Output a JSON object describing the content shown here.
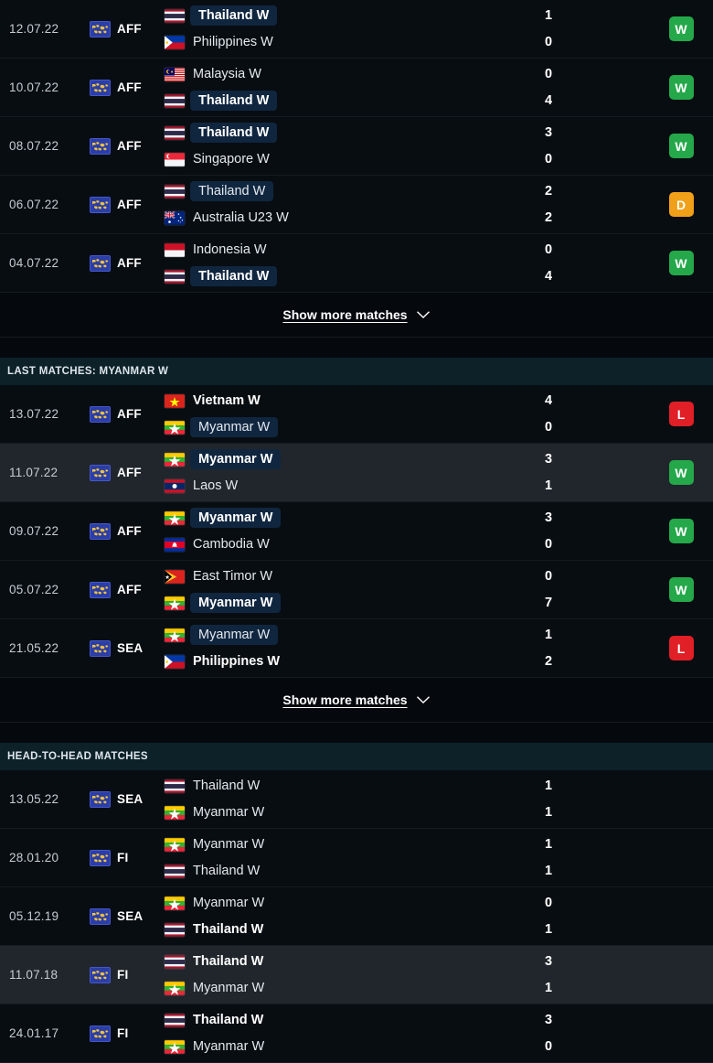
{
  "sections": [
    {
      "id": "last-matches-thailand",
      "header": null,
      "show_more_label": "Show more matches",
      "matches": [
        {
          "date": "12.07.22",
          "competition": "AFF",
          "comp_icon": "world-map-icon",
          "alt": false,
          "home": {
            "name": "Thailand W",
            "flag": "thailand",
            "highlight": true,
            "winner": true
          },
          "away": {
            "name": "Philippines W",
            "flag": "philippines",
            "highlight": false,
            "winner": false
          },
          "score_home": "1",
          "score_away": "0",
          "result": "W"
        },
        {
          "date": "10.07.22",
          "competition": "AFF",
          "comp_icon": "world-map-icon",
          "alt": false,
          "home": {
            "name": "Malaysia W",
            "flag": "malaysia",
            "highlight": false,
            "winner": false
          },
          "away": {
            "name": "Thailand W",
            "flag": "thailand",
            "highlight": true,
            "winner": true
          },
          "score_home": "0",
          "score_away": "4",
          "result": "W"
        },
        {
          "date": "08.07.22",
          "competition": "AFF",
          "comp_icon": "world-map-icon",
          "alt": false,
          "home": {
            "name": "Thailand W",
            "flag": "thailand",
            "highlight": true,
            "winner": true
          },
          "away": {
            "name": "Singapore W",
            "flag": "singapore",
            "highlight": false,
            "winner": false
          },
          "score_home": "3",
          "score_away": "0",
          "result": "W"
        },
        {
          "date": "06.07.22",
          "competition": "AFF",
          "comp_icon": "world-map-icon",
          "alt": false,
          "home": {
            "name": "Thailand W",
            "flag": "thailand",
            "highlight": true,
            "winner": false
          },
          "away": {
            "name": "Australia U23 W",
            "flag": "australia",
            "highlight": false,
            "winner": false
          },
          "score_home": "2",
          "score_away": "2",
          "result": "D"
        },
        {
          "date": "04.07.22",
          "competition": "AFF",
          "comp_icon": "world-map-icon",
          "alt": false,
          "home": {
            "name": "Indonesia W",
            "flag": "indonesia",
            "highlight": false,
            "winner": false
          },
          "away": {
            "name": "Thailand W",
            "flag": "thailand",
            "highlight": true,
            "winner": true
          },
          "score_home": "0",
          "score_away": "4",
          "result": "W"
        }
      ]
    },
    {
      "id": "last-matches-myanmar",
      "header": "LAST MATCHES: MYANMAR W",
      "show_more_label": "Show more matches",
      "matches": [
        {
          "date": "13.07.22",
          "competition": "AFF",
          "comp_icon": "world-map-icon",
          "alt": false,
          "home": {
            "name": "Vietnam W",
            "flag": "vietnam",
            "highlight": false,
            "winner": true
          },
          "away": {
            "name": "Myanmar W",
            "flag": "myanmar",
            "highlight": true,
            "winner": false
          },
          "score_home": "4",
          "score_away": "0",
          "result": "L"
        },
        {
          "date": "11.07.22",
          "competition": "AFF",
          "comp_icon": "world-map-icon",
          "alt": true,
          "home": {
            "name": "Myanmar W",
            "flag": "myanmar",
            "highlight": true,
            "winner": true
          },
          "away": {
            "name": "Laos W",
            "flag": "laos",
            "highlight": false,
            "winner": false
          },
          "score_home": "3",
          "score_away": "1",
          "result": "W"
        },
        {
          "date": "09.07.22",
          "competition": "AFF",
          "comp_icon": "world-map-icon",
          "alt": false,
          "home": {
            "name": "Myanmar W",
            "flag": "myanmar",
            "highlight": true,
            "winner": true
          },
          "away": {
            "name": "Cambodia W",
            "flag": "cambodia",
            "highlight": false,
            "winner": false
          },
          "score_home": "3",
          "score_away": "0",
          "result": "W"
        },
        {
          "date": "05.07.22",
          "competition": "AFF",
          "comp_icon": "world-map-icon",
          "alt": false,
          "home": {
            "name": "East Timor W",
            "flag": "easttimor",
            "highlight": false,
            "winner": false
          },
          "away": {
            "name": "Myanmar W",
            "flag": "myanmar",
            "highlight": true,
            "winner": true
          },
          "score_home": "0",
          "score_away": "7",
          "result": "W"
        },
        {
          "date": "21.05.22",
          "competition": "SEA",
          "comp_icon": "world-map-icon",
          "alt": false,
          "home": {
            "name": "Myanmar W",
            "flag": "myanmar",
            "highlight": true,
            "winner": false
          },
          "away": {
            "name": "Philippines W",
            "flag": "philippines",
            "highlight": false,
            "winner": true
          },
          "score_home": "1",
          "score_away": "2",
          "result": "L"
        }
      ]
    },
    {
      "id": "head-to-head",
      "header": "HEAD-TO-HEAD MATCHES",
      "show_more_label": null,
      "matches": [
        {
          "date": "13.05.22",
          "competition": "SEA",
          "comp_icon": "world-map-icon",
          "alt": false,
          "home": {
            "name": "Thailand W",
            "flag": "thailand",
            "highlight": false,
            "winner": false
          },
          "away": {
            "name": "Myanmar W",
            "flag": "myanmar",
            "highlight": false,
            "winner": false
          },
          "score_home": "1",
          "score_away": "1",
          "result": ""
        },
        {
          "date": "28.01.20",
          "competition": "FI",
          "comp_icon": "world-map-icon",
          "alt": false,
          "home": {
            "name": "Myanmar W",
            "flag": "myanmar",
            "highlight": false,
            "winner": false
          },
          "away": {
            "name": "Thailand W",
            "flag": "thailand",
            "highlight": false,
            "winner": false
          },
          "score_home": "1",
          "score_away": "1",
          "result": ""
        },
        {
          "date": "05.12.19",
          "competition": "SEA",
          "comp_icon": "world-map-icon",
          "alt": false,
          "home": {
            "name": "Myanmar W",
            "flag": "myanmar",
            "highlight": false,
            "winner": false
          },
          "away": {
            "name": "Thailand W",
            "flag": "thailand",
            "highlight": false,
            "winner": true
          },
          "score_home": "0",
          "score_away": "1",
          "result": ""
        },
        {
          "date": "11.07.18",
          "competition": "FI",
          "comp_icon": "world-map-icon",
          "alt": true,
          "home": {
            "name": "Thailand W",
            "flag": "thailand",
            "highlight": false,
            "winner": true
          },
          "away": {
            "name": "Myanmar W",
            "flag": "myanmar",
            "highlight": false,
            "winner": false
          },
          "score_home": "3",
          "score_away": "1",
          "result": ""
        },
        {
          "date": "24.01.17",
          "competition": "FI",
          "comp_icon": "world-map-icon",
          "alt": false,
          "home": {
            "name": "Thailand W",
            "flag": "thailand",
            "highlight": false,
            "winner": true
          },
          "away": {
            "name": "Myanmar W",
            "flag": "myanmar",
            "highlight": false,
            "winner": false
          },
          "score_home": "3",
          "score_away": "0",
          "result": ""
        }
      ]
    }
  ],
  "colors": {
    "background": "#05090d",
    "row": "#080d12",
    "row_alt": "#20262b",
    "section_header": "#0c2128",
    "pill": "#10263f",
    "win": "#24a84a",
    "draw": "#f0a019",
    "loss": "#e01f26"
  }
}
